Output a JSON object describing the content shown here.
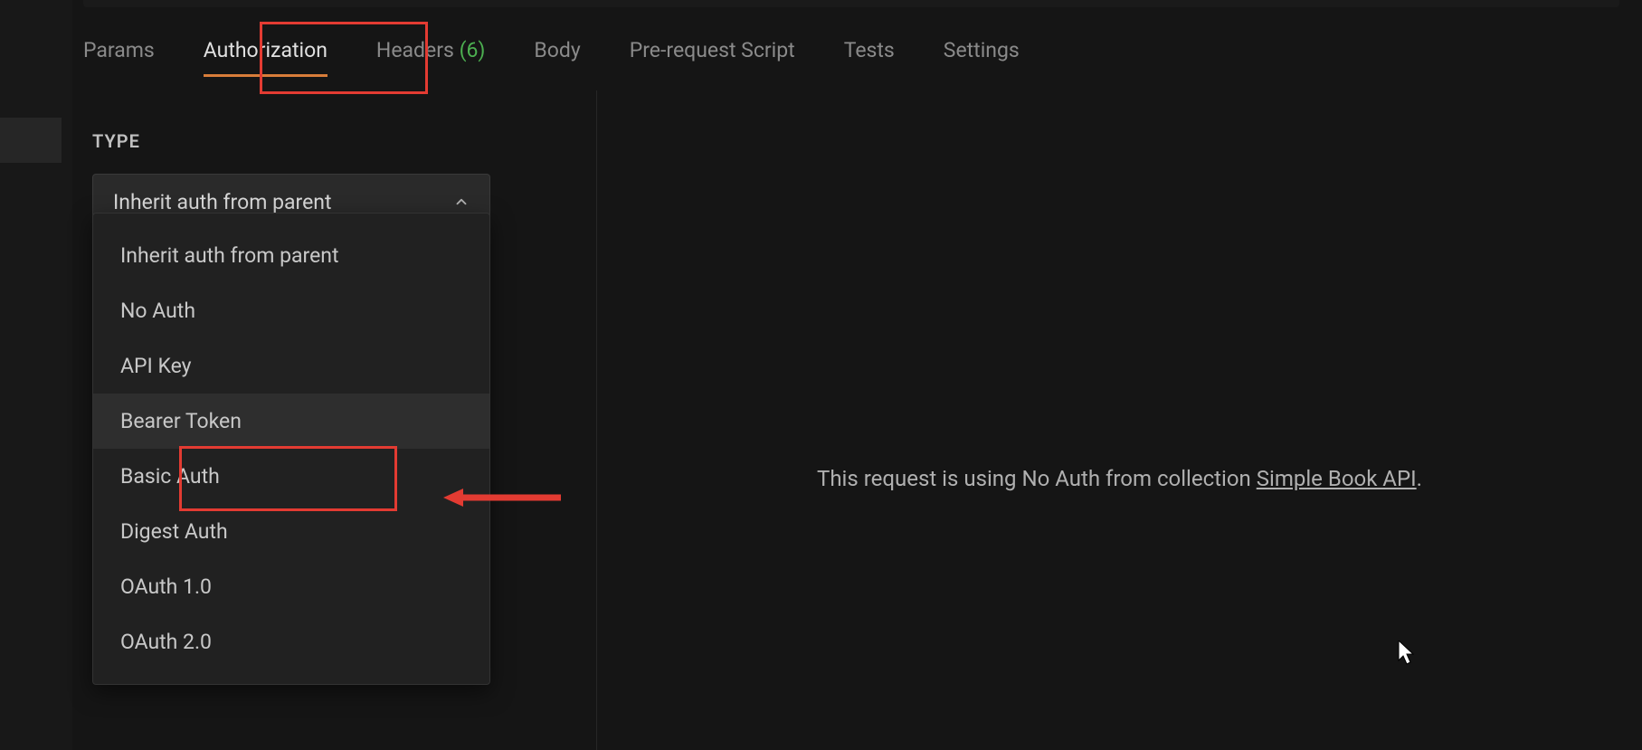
{
  "tabs": {
    "params": "Params",
    "authorization": "Authorization",
    "headers_label": "Headers",
    "headers_count": "(6)",
    "body": "Body",
    "prerequest": "Pre-request Script",
    "tests": "Tests",
    "settings": "Settings"
  },
  "auth": {
    "type_label": "TYPE",
    "selected": "Inherit auth from parent",
    "options": [
      "Inherit auth from parent",
      "No Auth",
      "API Key",
      "Bearer Token",
      "Basic Auth",
      "Digest Auth",
      "OAuth 1.0",
      "OAuth 2.0"
    ],
    "message_prefix": "This request is using No Auth from collection ",
    "collection_link": "Simple Book API",
    "message_suffix": "."
  }
}
